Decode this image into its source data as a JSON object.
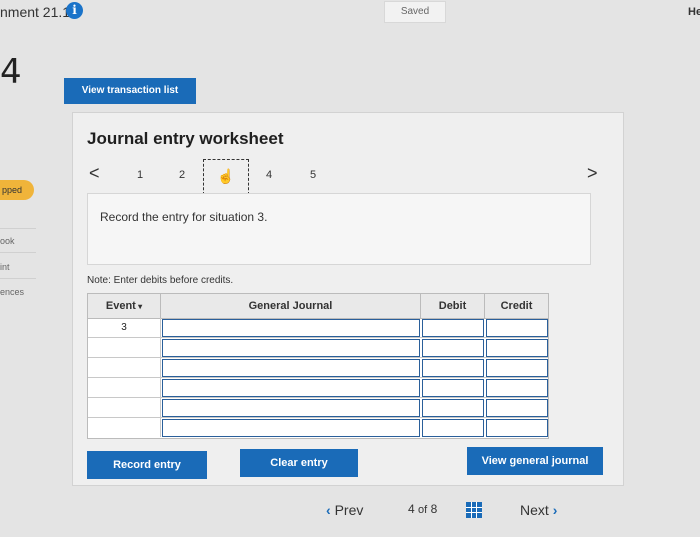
{
  "header": {
    "assignment_title": "nment 21.1",
    "info_icon": "info-icon",
    "saved_label": "Saved",
    "help_label": "He"
  },
  "question_number": "4",
  "sidebar": {
    "items": [
      "pped",
      "ook",
      "int",
      "ences"
    ]
  },
  "toolbar": {
    "view_transaction_list": "View transaction list"
  },
  "worksheet": {
    "title": "Journal entry worksheet",
    "pager": {
      "prev": "<",
      "next": ">",
      "pages": [
        "1",
        "2",
        "3",
        "4",
        "5"
      ],
      "current_index": 2
    },
    "instruction": "Record the entry for situation 3.",
    "note": "Note: Enter debits before credits.",
    "table": {
      "headers": {
        "event": "Event",
        "general_journal": "General Journal",
        "debit": "Debit",
        "credit": "Credit"
      },
      "rows": [
        {
          "event": "3"
        },
        {
          "event": ""
        },
        {
          "event": ""
        },
        {
          "event": ""
        },
        {
          "event": ""
        },
        {
          "event": ""
        }
      ]
    },
    "buttons": {
      "record_entry": "Record entry",
      "clear_entry": "Clear entry",
      "view_general_journal": "View general journal"
    }
  },
  "footer": {
    "prev": "Prev",
    "page_current": "4",
    "page_of": "of",
    "page_total": "8",
    "next": "Next"
  },
  "colors": {
    "primary": "#1a6bb8",
    "skipped": "#f0b43a",
    "info": "#1a73c9"
  }
}
